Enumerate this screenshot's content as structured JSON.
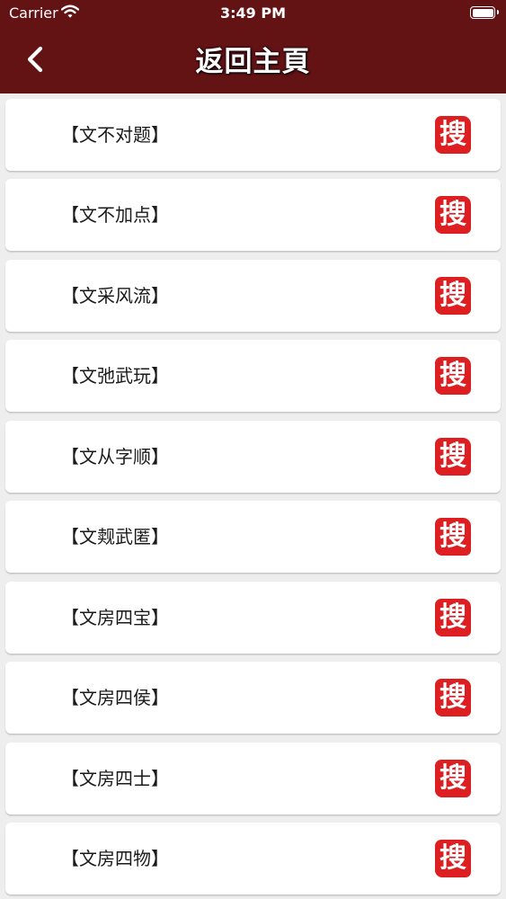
{
  "status_bar": {
    "carrier": "Carrier",
    "time": "3:49 PM"
  },
  "header": {
    "title": "返回主頁"
  },
  "list": {
    "items": [
      {
        "label": "【文不对题】",
        "stamp": "搜"
      },
      {
        "label": "【文不加点】",
        "stamp": "搜"
      },
      {
        "label": "【文采风流】",
        "stamp": "搜"
      },
      {
        "label": "【文弛武玩】",
        "stamp": "搜"
      },
      {
        "label": "【文从字顺】",
        "stamp": "搜"
      },
      {
        "label": "【文觌武匿】",
        "stamp": "搜"
      },
      {
        "label": "【文房四宝】",
        "stamp": "搜"
      },
      {
        "label": "【文房四侯】",
        "stamp": "搜"
      },
      {
        "label": "【文房四士】",
        "stamp": "搜"
      },
      {
        "label": "【文房四物】",
        "stamp": "搜"
      }
    ]
  },
  "colors": {
    "header": "#641315",
    "stamp": "#dd1f22",
    "background": "#eeeeee"
  }
}
